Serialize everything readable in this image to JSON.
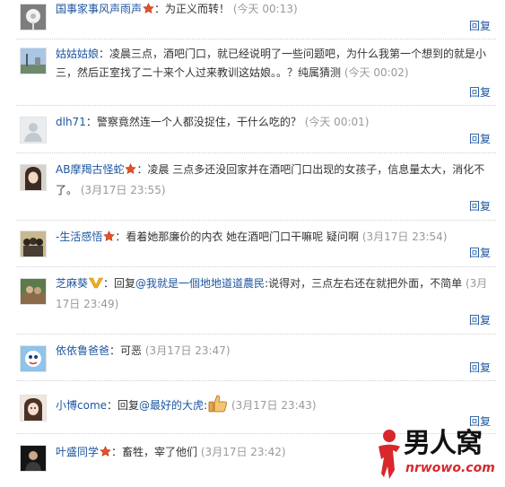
{
  "reply_label": "回复",
  "comments": [
    {
      "user": "国事家事风声雨声",
      "badge": "vip-star",
      "sep": "：",
      "body": "为正义而转！",
      "time": "(今天 00:13)"
    },
    {
      "user": "姑姑姑娘",
      "sep": "：",
      "body": "凌晨三点，酒吧门口，就已经说明了一些问题吧，为什么我第一个想到的就是小三，然后正室找了二十来个人过来教训这姑娘。。？纯属猜测",
      "time": "(今天 00:02)"
    },
    {
      "user": "dlh71",
      "sep": "：",
      "body": "警察竟然连一个人都没捉住，干什么吃的？",
      "time": "(今天 00:01)"
    },
    {
      "user": "AB摩羯古怪蛇",
      "badge": "vip-star",
      "sep": "：",
      "body": "凌晨 三点多还没回家并在酒吧门口出现的女孩子，信息量太大，消化不了。",
      "time": "(3月17日 23:55)"
    },
    {
      "user": "-生活感悟",
      "badge": "vip-star",
      "sep": "：",
      "body": "看着她那廉价的内衣 她在酒吧门口干嘛呢 疑问啊",
      "time": "(3月17日 23:54)"
    },
    {
      "user": "芝麻葵",
      "badge": "v-badge",
      "sep": "：",
      "reply_prefix": "回复",
      "mention": "@我就是一個地地道道農民",
      "body": ":说得对，三点左右还在就把外面，不简单",
      "time": "(3月17日 23:49)"
    },
    {
      "user": "依依鲁爸爸",
      "sep": "：",
      "body": "可恶",
      "time": "(3月17日 23:47)"
    },
    {
      "user": "小博come",
      "sep": "：",
      "reply_prefix": "回复",
      "mention": "@最好的大虎",
      "body": ":",
      "emoji": "thumbs-up-icon",
      "time": "(3月17日 23:43)"
    },
    {
      "user": "叶盛同学",
      "badge": "vip-star",
      "sep": "：",
      "body": "畜牲，宰了他们",
      "time": "(3月17日 23:42)"
    }
  ],
  "watermark": {
    "brand": "男人窝",
    "url": "nrwowo.com"
  },
  "colors": {
    "link": "#1e56a0",
    "time": "#999999",
    "text": "#333333",
    "divider": "#cfcfcf",
    "watermark_red": "#d8282c"
  }
}
